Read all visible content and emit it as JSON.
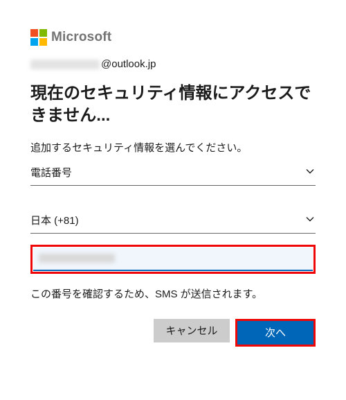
{
  "brand": "Microsoft",
  "account": {
    "prefix_hidden": true,
    "domain_suffix": "@outlook.jp"
  },
  "title": "現在のセキュリティ情報にアクセスできません...",
  "subtitle": "追加するセキュリティ情報を選んでください。",
  "method_select": {
    "value": "電話番号"
  },
  "country_select": {
    "value": "日本 (+81)"
  },
  "phone_input": {
    "value_hidden": true
  },
  "helper_text": "この番号を確認するため、SMS が送信されます。",
  "buttons": {
    "cancel": "キャンセル",
    "next": "次へ"
  },
  "highlight_color": "#ef0707",
  "accent_color": "#0067b8"
}
